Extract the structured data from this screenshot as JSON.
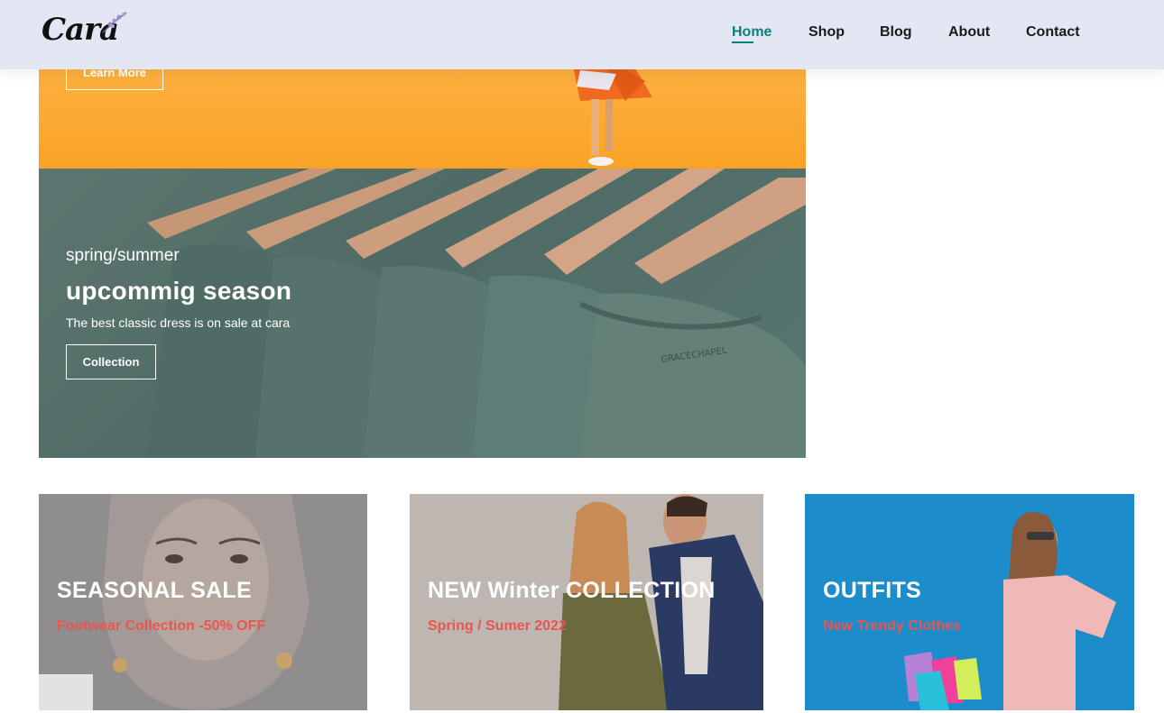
{
  "header": {
    "logo_text": "Cara",
    "nav": [
      {
        "label": "Home",
        "active": true
      },
      {
        "label": "Shop",
        "active": false
      },
      {
        "label": "Blog",
        "active": false
      },
      {
        "label": "About",
        "active": false
      },
      {
        "label": "Contact",
        "active": false
      }
    ]
  },
  "hero_top": {
    "button_label": "Learn More"
  },
  "hero_bottom": {
    "subtitle": "spring/summer",
    "title": "upcommig season",
    "description": "The best classic dress is on sale at cara",
    "button_label": "Collection"
  },
  "banners": [
    {
      "title": "SEASONAL SALE",
      "subtitle": "Footwear Collection -50% OFF"
    },
    {
      "title": "NEW Winter COLLECTION",
      "subtitle": "Spring / Sumer 2022"
    },
    {
      "title": "OUTFITS",
      "subtitle": "New Trendy Clothes"
    }
  ],
  "colors": {
    "accent": "#088178",
    "header_bg": "#e3e6f3",
    "banner_subtitle": "#ec544e",
    "hero_orange": "#fcac38",
    "hero_green": "#587670"
  }
}
